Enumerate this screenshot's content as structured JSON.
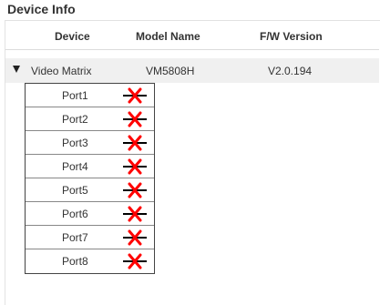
{
  "section": {
    "title": "Device Info"
  },
  "table": {
    "headers": {
      "device": "Device",
      "model": "Model Name",
      "fw": "F/W Version"
    },
    "device": {
      "name": "Video Matrix",
      "model": "VM5808H",
      "fw": "V2.0.194",
      "expanded": true
    },
    "ports": [
      {
        "label": "Port1",
        "status": "disconnected"
      },
      {
        "label": "Port2",
        "status": "disconnected"
      },
      {
        "label": "Port3",
        "status": "disconnected"
      },
      {
        "label": "Port4",
        "status": "disconnected"
      },
      {
        "label": "Port5",
        "status": "disconnected"
      },
      {
        "label": "Port6",
        "status": "disconnected"
      },
      {
        "label": "Port7",
        "status": "disconnected"
      },
      {
        "label": "Port8",
        "status": "disconnected"
      }
    ]
  },
  "icons": {
    "expand": "triangle-down-icon",
    "port_status": "disconnected-x-icon"
  },
  "colors": {
    "status_x": "#ff0000",
    "link_line": "#000000",
    "row_highlight": "#f0f0f0"
  }
}
